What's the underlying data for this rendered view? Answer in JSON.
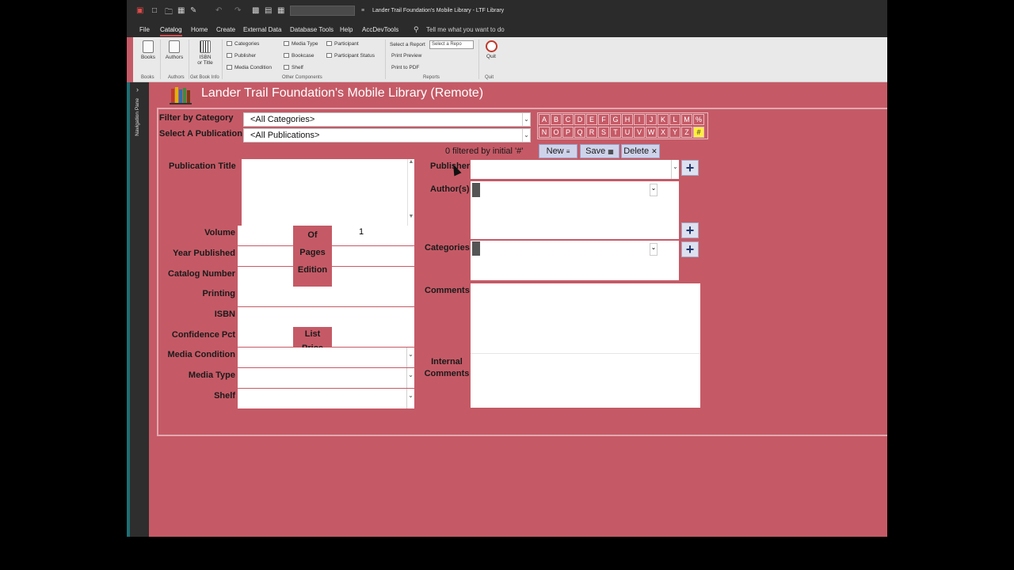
{
  "window": {
    "title": "Lander Trail Foundation's Mobile Library  -  LTF Library"
  },
  "ribbon": {
    "tabs": [
      "File",
      "Catalog",
      "Home",
      "Create",
      "External Data",
      "Database Tools",
      "Help",
      "AccDevTools"
    ],
    "active_tab": "Catalog",
    "tell_me": "Tell me what you want to do",
    "books_label": "Books",
    "authors_label": "Authors",
    "isbn_label": "ISBN",
    "or_title_label": "or Title",
    "categories_label": "Categories",
    "publisher_label": "Publisher",
    "media_condition_label": "Media Condition",
    "media_type_label": "Media Type",
    "bookcase_label": "Bookcase",
    "shelf_label": "Shelf",
    "participant_label": "Participant",
    "participant_status_label": "Participant Status",
    "select_report_label": "Select a Report",
    "select_report_placeholder": "Select a Repo",
    "print_preview_label": "Print Preview",
    "print_pdf_label": "Print to PDF",
    "quit_label": "Quit",
    "groups": {
      "books": "Books",
      "authors": "Authors",
      "get_book_info": "Get Book Info",
      "other_components": "Other Components",
      "reports": "Reports",
      "quit": "Quit"
    }
  },
  "nav_pane": {
    "label": "Navigation Pane"
  },
  "form": {
    "title": "Lander Trail Foundation's Mobile Library  (Remote)",
    "filter_by_category_label": "Filter by Category",
    "filter_by_category_value": "<All Categories>",
    "select_publication_label": "Select A Publication",
    "select_publication_value": "<All Publications>",
    "filter_status": "0 filtered by initial '#'",
    "letters_row1": [
      "A",
      "B",
      "C",
      "D",
      "E",
      "F",
      "G",
      "H",
      "I",
      "J",
      "K",
      "L",
      "M",
      "%"
    ],
    "letters_row2": [
      "N",
      "O",
      "P",
      "Q",
      "R",
      "S",
      "T",
      "U",
      "V",
      "W",
      "X",
      "Y",
      "Z",
      "#"
    ],
    "selected_letter": "#",
    "new_button": "New",
    "save_button": "Save",
    "delete_button": "Delete",
    "publication_title_label": "Publication Title",
    "volume_label": "Volume",
    "of_label": "Of",
    "volume_of_value": "1",
    "year_published_label": "Year Published",
    "pages_label": "Pages",
    "catalog_number_label": "Catalog Number",
    "edition_label": "Edition",
    "printing_label": "Printing",
    "isbn_label": "ISBN",
    "confidence_pct_label": "Confidence Pct",
    "list_price_label": "List Price",
    "media_condition_label": "Media Condition",
    "media_type_label": "Media Type",
    "shelf_label": "Shelf",
    "publisher_label": "Publisher",
    "authors_label": "Author(s)",
    "categories_label": "Categories",
    "comments_label": "Comments",
    "internal_comments_label": "Internal\nComments"
  },
  "colors": {
    "form_background": "#c55a66",
    "selected_letter": "#ffef3a",
    "action_button": "#cfd3ea"
  }
}
